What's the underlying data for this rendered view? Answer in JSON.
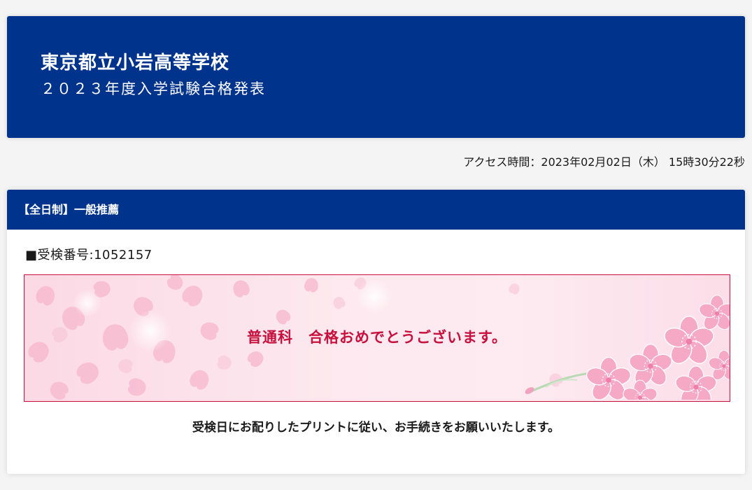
{
  "header": {
    "school_name": "東京都立小岩高等学校",
    "exam_title": "２０２３年度入学試験合格発表"
  },
  "access": {
    "time_text": "アクセス時間：2023年02月02日（木） 15時30分22秒"
  },
  "result_card": {
    "category_title": "【全日制】一般推薦",
    "exam_number_text": "■受検番号:1052157",
    "result_message": "普通科　合格おめでとうございます。",
    "procedure_note": "受検日にお配りしたプリントに従い、お手続きをお願いいたします。",
    "decoration": "cherry-blossom-illustration"
  },
  "colors": {
    "header_blue": "#00338c",
    "result_red": "#c8103e",
    "blossom_pink": "#f4a3c0",
    "background": "#f4f4f4"
  }
}
